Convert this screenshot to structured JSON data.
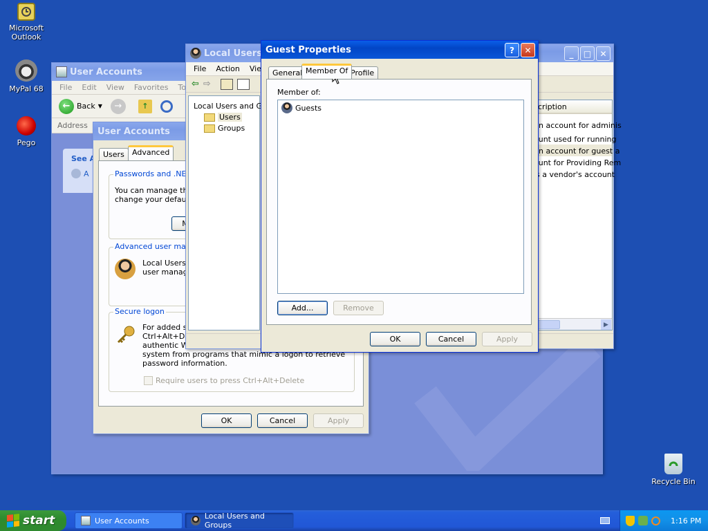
{
  "desktop": {
    "icons": [
      {
        "label": "Microsoft Outlook"
      },
      {
        "label": "MyPal 68"
      },
      {
        "label": "Pego"
      },
      {
        "label": "Recycle Bin"
      }
    ]
  },
  "ua_main": {
    "title": "User Accounts",
    "menu": [
      "File",
      "Edit",
      "View",
      "Favorites",
      "Too"
    ],
    "back_label": "Back",
    "address_label": "Address",
    "see_also": "See A",
    "see_item": "A"
  },
  "ua_dialog": {
    "title": "User Accounts",
    "tabs": [
      "Users",
      "Advanced"
    ],
    "passwords_title": "Passwords and .NET P",
    "passwords_text1": "You can manage the",
    "passwords_text2": "change your default",
    "manage_btn": "M",
    "advanced_title": "Advanced user mana",
    "advanced_text1": "Local Users a",
    "advanced_text2": "user manage",
    "secure_title": "Secure logon",
    "secure_text1": "For added se",
    "secure_text2": "Ctrl+Alt+Del",
    "secure_text3": "authentic Wi",
    "secure_text4": "system from programs that mimic a logon to retrieve",
    "secure_text5": "password information.",
    "require_label": "Require users to press Ctrl+Alt+Delete",
    "ok": "OK",
    "cancel": "Cancel",
    "apply": "Apply"
  },
  "lusrmgr": {
    "title": "Local Users and Groups",
    "title_visible": "Local Users a",
    "menu": [
      "File",
      "Action",
      "View"
    ],
    "tree": {
      "root": "Local Users and G",
      "users": "Users",
      "groups": "Groups"
    },
    "desc_header": "cription",
    "descriptions": [
      "-in account for adminis",
      "ount used for running",
      "-in account for guest a",
      "ount for Providing Rem",
      "is a vendor's account"
    ]
  },
  "guest_props": {
    "title": "Guest Properties",
    "help_btn": "?",
    "tabs": [
      "General",
      "Member Of",
      "Profile"
    ],
    "member_of_label": "Member of:",
    "members": [
      "Guests"
    ],
    "add_btn": "Add...",
    "remove_btn": "Remove",
    "ok": "OK",
    "cancel": "Cancel",
    "apply": "Apply"
  },
  "taskbar": {
    "start": "start",
    "items": [
      "User Accounts",
      "Local Users and Groups"
    ],
    "clock": "1:16 PM"
  }
}
